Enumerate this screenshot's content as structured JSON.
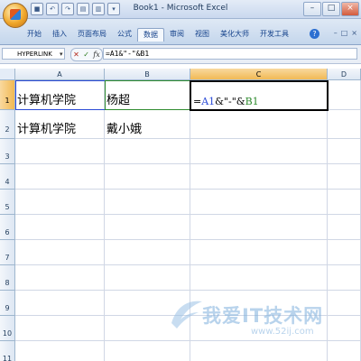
{
  "window": {
    "title": "Book1 - Microsoft Excel",
    "controls": [
      "–",
      "□",
      "×"
    ]
  },
  "quick_access": [
    "save-icon",
    "undo-icon",
    "redo-icon",
    "document-icon",
    "print-icon",
    "dropdown-icon"
  ],
  "ribbon": {
    "tabs": [
      "开始",
      "插入",
      "页面布局",
      "公式",
      "数据",
      "审阅",
      "视图",
      "美化大师",
      "开发工具"
    ],
    "active_tab_index": 4,
    "help_symbol": "?",
    "right_controls": [
      "–",
      "□",
      "×"
    ]
  },
  "formula_bar": {
    "name_box": "HYPERLINK",
    "cancel_symbol": "✕",
    "enter_symbol": "✓",
    "fx_label": "fx",
    "formula": "=A1&\"-\"&B1"
  },
  "sheet": {
    "columns": [
      "A",
      "B",
      "C",
      "D"
    ],
    "selected_column": "C",
    "rows": [
      "1",
      "2",
      "3",
      "4",
      "5",
      "6",
      "7",
      "8",
      "9",
      "10",
      "11"
    ],
    "selected_row": "1",
    "cells": {
      "A1": "计算机学院",
      "B1": "杨超",
      "C1": "=A1&\"-\"&B1",
      "A2": "计算机学院",
      "B2": "戴小娥"
    },
    "formula_parts": {
      "eq": "=",
      "ref_a1": "A1",
      "mid": "&\"-\"&",
      "ref_b1": "B1"
    }
  },
  "watermark": {
    "text": "我爱IT技术网",
    "url": "www.52ij.com"
  }
}
